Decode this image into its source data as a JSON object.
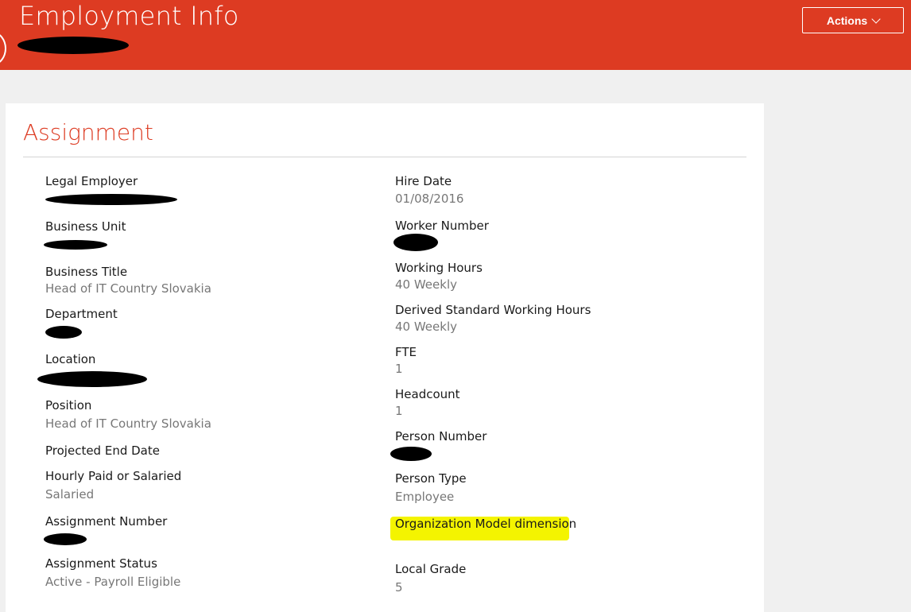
{
  "header": {
    "title": "Employment Info",
    "actions_label": "Actions"
  },
  "section": {
    "title": "Assignment"
  },
  "left_fields": [
    {
      "label": "Legal Employer",
      "value": ""
    },
    {
      "label": "Business Unit",
      "value": ""
    },
    {
      "label": "Business Title",
      "value": "Head of IT Country Slovakia"
    },
    {
      "label": "Department",
      "value": ""
    },
    {
      "label": "Location",
      "value": ""
    },
    {
      "label": "Position",
      "value": "Head of IT Country Slovakia"
    },
    {
      "label": "Projected End Date",
      "value": ""
    },
    {
      "label": "Hourly Paid or Salaried",
      "value": "Salaried"
    },
    {
      "label": "Assignment Number",
      "value": ""
    },
    {
      "label": "Assignment Status",
      "value": "Active - Payroll Eligible"
    }
  ],
  "right_fields": [
    {
      "label": "Hire Date",
      "value": "01/08/2016"
    },
    {
      "label": "Worker Number",
      "value": ""
    },
    {
      "label": "Working Hours",
      "value": "40 Weekly"
    },
    {
      "label": "Derived Standard Working Hours",
      "value": "40 Weekly"
    },
    {
      "label": "FTE",
      "value": "1"
    },
    {
      "label": "Headcount",
      "value": "1"
    },
    {
      "label": "Person Number",
      "value": ""
    },
    {
      "label": "Person Type",
      "value": "Employee"
    },
    {
      "label": "Organization Model dimension",
      "value": ""
    },
    {
      "label": "Local Grade",
      "value": "5"
    }
  ],
  "colors": {
    "brand": "#dd3b22",
    "highlight": "#f4f400",
    "label": "#1a1a1a",
    "value": "#777777"
  }
}
